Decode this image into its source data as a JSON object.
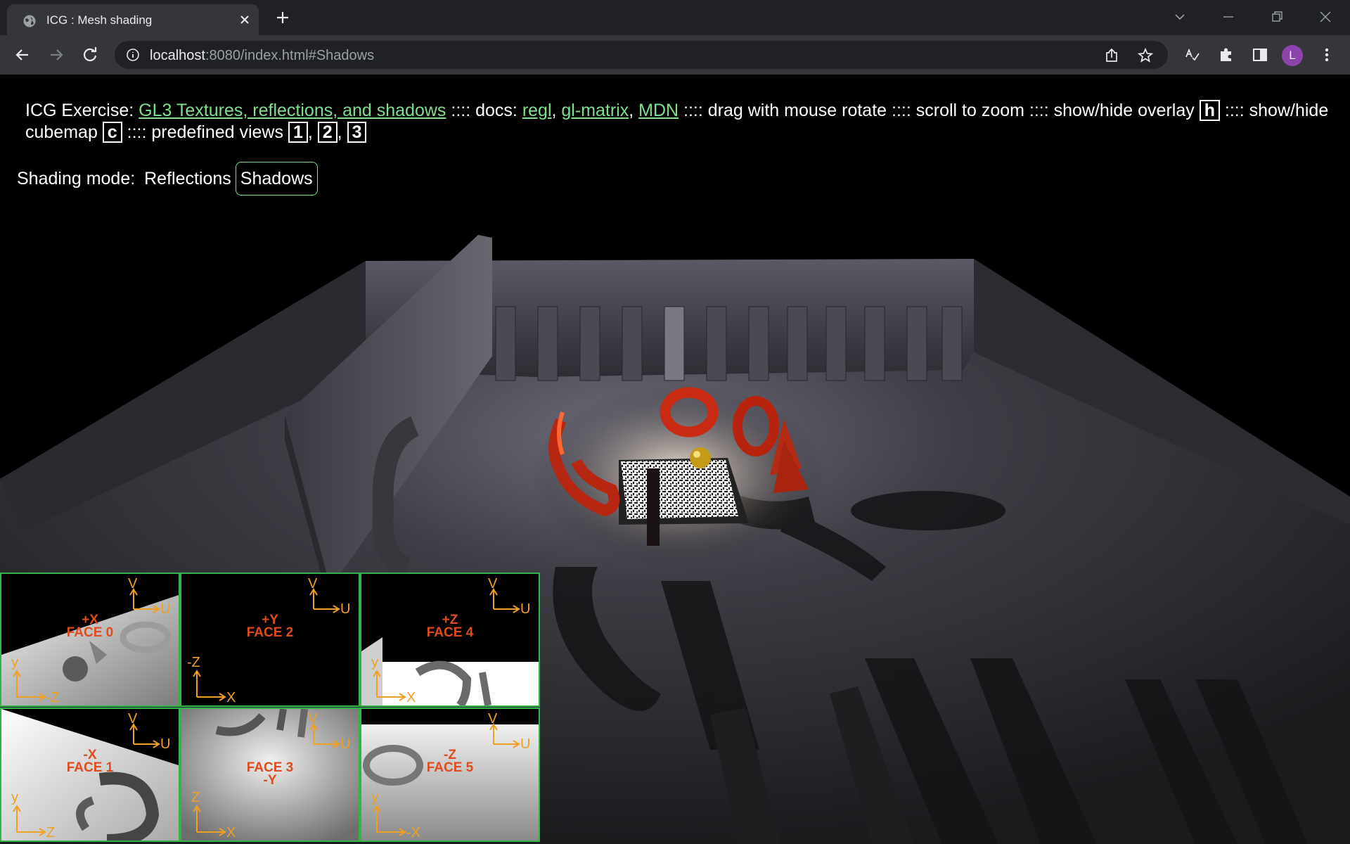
{
  "browser": {
    "tab_title": "ICG : Mesh shading",
    "url_host": "localhost",
    "url_rest": ":8080/index.html#Shadows",
    "profile_initial": "L"
  },
  "overlay": {
    "prefix": "ICG Exercise: ",
    "exercise_link": "GL3 Textures, reflections, and shadows",
    "docs_label": " :::: docs: ",
    "doc_links": [
      "regl",
      "gl-matrix",
      "MDN"
    ],
    "instructions": " :::: drag with mouse rotate :::: scroll to zoom :::: show/hide overlay ",
    "key_overlay": "h",
    "cubemap_text": " :::: show/hide cubemap ",
    "key_cubemap": "c",
    "views_text": " :::: predefined views ",
    "view_keys": [
      "1",
      "2",
      "3"
    ]
  },
  "shading_mode": {
    "label": "Shading mode: ",
    "options": [
      "Reflections",
      "Shadows"
    ],
    "selected": "Shadows"
  },
  "cubemap_faces": [
    {
      "line1": "+X",
      "line2": "FACE 0",
      "top_v": "V",
      "top_u": "U",
      "bot_y": "y",
      "bot_x": "-Z"
    },
    {
      "line1": "+Y",
      "line2": "FACE 2",
      "top_v": "V",
      "top_u": "U",
      "bot_y": "-Z",
      "bot_x": "X"
    },
    {
      "line1": "+Z",
      "line2": "FACE 4",
      "top_v": "V",
      "top_u": "U",
      "bot_y": "y",
      "bot_x": "X"
    },
    {
      "line1": "-X",
      "line2": "FACE 1",
      "top_v": "V",
      "top_u": "U",
      "bot_y": "y",
      "bot_x": "Z"
    },
    {
      "line1": "FACE 3",
      "line2": "-Y",
      "top_v": "V",
      "top_u": "U",
      "bot_y": "Z",
      "bot_x": "X"
    },
    {
      "line1": "-Z",
      "line2": "FACE 5",
      "top_v": "V",
      "top_u": "U",
      "bot_y": "y",
      "bot_x": "-X"
    }
  ],
  "colors": {
    "link": "#7ee08a",
    "face_border": "#31b54a",
    "face_label": "#e04b1c",
    "axis": "#f0a020"
  }
}
